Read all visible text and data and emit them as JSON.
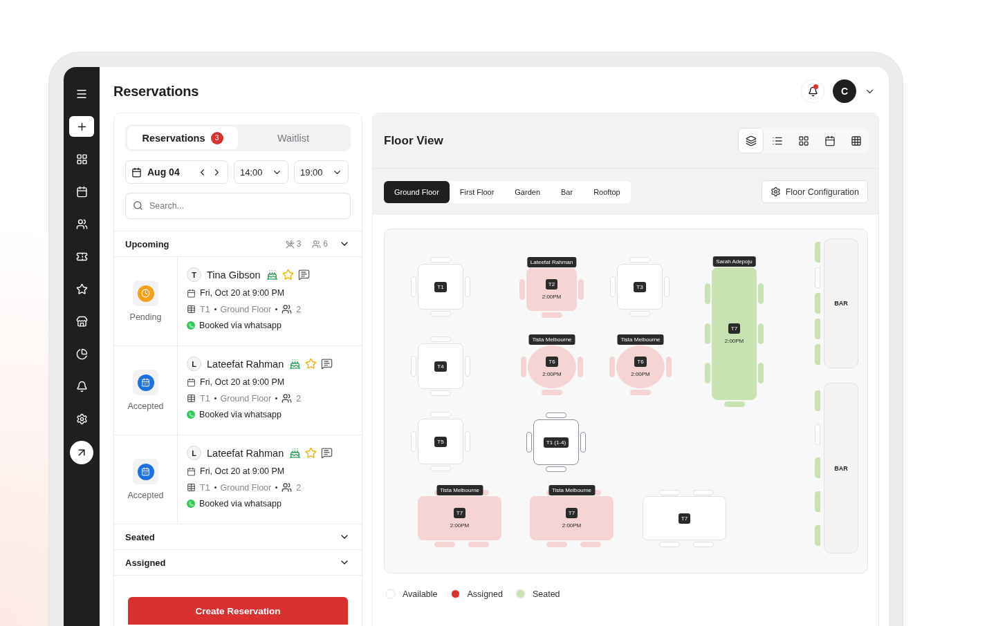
{
  "header": {
    "title": "Reservations",
    "avatar": "C",
    "has_notification": true
  },
  "panel": {
    "tabs": [
      {
        "label": "Reservations",
        "badge": "3",
        "selected": true
      },
      {
        "label": "Waitlist",
        "selected": false
      }
    ],
    "date": "Aug 04",
    "time_from": "14:00",
    "time_to": "19:00",
    "search": {
      "placeholder": "Search..."
    },
    "sections": [
      {
        "title": "Upcoming",
        "utensils_count": "3",
        "guests_count": "6",
        "items": [
          {
            "kind": "pending",
            "status_label": "Pending",
            "initial": "T",
            "name": "Tina Gibson",
            "datetime": "Fri, Oct 20 at 9:00 PM",
            "table": "T1",
            "floor": "Ground Floor",
            "guests": "2",
            "source": "Booked via whatsapp"
          },
          {
            "kind": "accepted",
            "status_label": "Accepted",
            "initial": "L",
            "name": "Lateefat Rahman",
            "datetime": "Fri, Oct 20 at 9:00 PM",
            "table": "T1",
            "floor": "Ground Floor",
            "guests": "2",
            "source": "Booked via whatsapp"
          },
          {
            "kind": "accepted",
            "status_label": "Accepted",
            "initial": "L",
            "name": "Lateefat Rahman",
            "datetime": "Fri, Oct 20 at 9:00 PM",
            "table": "T1",
            "floor": "Ground Floor",
            "guests": "2",
            "source": "Booked via whatsapp"
          }
        ]
      },
      {
        "title": "Seated"
      },
      {
        "title": "Assigned"
      }
    ],
    "create_button": "Create Reservation"
  },
  "floor": {
    "title": "Floor View",
    "view_modes": [
      {
        "selected": true
      },
      {
        "selected": false
      },
      {
        "selected": false
      },
      {
        "selected": false
      },
      {
        "selected": false
      }
    ],
    "floors": [
      {
        "label": "Ground Floor",
        "selected": true
      },
      {
        "label": "First Floor",
        "selected": false
      },
      {
        "label": "Garden",
        "selected": false
      },
      {
        "label": "Bar",
        "selected": false
      },
      {
        "label": "Rooftop",
        "selected": false
      }
    ],
    "config_button": "Floor Configuration",
    "tables": [
      {
        "label": "T1",
        "kind": "square",
        "color": "#ffffff",
        "selected": false
      },
      {
        "label": "T2",
        "kind": "square",
        "color": "#f6d4d4",
        "selected": false,
        "guest": "Lateefat Rahman",
        "time": "2:00PM"
      },
      {
        "label": "T3",
        "kind": "square",
        "color": "#ffffff",
        "selected": false
      },
      {
        "label": "T7",
        "kind": "tall",
        "color": "#c8e3b2",
        "selected": false,
        "guest": "Sarah Adepoju",
        "time": "2:00PM"
      },
      {
        "label": "T4",
        "kind": "square",
        "color": "#ffffff",
        "selected": false
      },
      {
        "label": "T6",
        "kind": "round",
        "color": "#f6d4d4",
        "selected": false,
        "guest": "Tista Melbourne",
        "time": "2:00PM"
      },
      {
        "label": "T6",
        "kind": "round",
        "color": "#f6d4d4",
        "selected": false,
        "guest": "Tista Melbourne",
        "time": "2:00PM"
      },
      {
        "label": "T5",
        "kind": "square",
        "color": "#ffffff",
        "selected": false
      },
      {
        "label": "T1 (1-4)",
        "kind": "square",
        "color": "#ffffff",
        "selected": true
      },
      {
        "label": "T7",
        "kind": "wide",
        "color": "#f6d4d4",
        "selected": false,
        "guest": "Tista Melbourne",
        "time": "2:00PM"
      },
      {
        "label": "T7",
        "kind": "wide",
        "color": "#f6d4d4",
        "selected": false,
        "guest": "Tista Melbourne",
        "time": "2:00PM"
      },
      {
        "label": "T7",
        "kind": "wide",
        "color": "#ffffff",
        "selected": false
      }
    ],
    "bars": [
      {
        "label": "BAR",
        "stools": [
          {
            "seated": true
          },
          {
            "seated": false
          },
          {
            "seated": true
          },
          {
            "seated": true
          },
          {
            "seated": true
          }
        ]
      },
      {
        "label": "BAR",
        "stools": [
          {
            "seated": true
          },
          {
            "seated": false
          },
          {
            "seated": true
          },
          {
            "seated": true
          },
          {
            "seated": true
          }
        ]
      }
    ],
    "legend": [
      {
        "label": "Available",
        "color": "#ffffff"
      },
      {
        "label": "Assigned",
        "color": "#d93030"
      },
      {
        "label": "Seated",
        "color": "#c8e3b2"
      }
    ]
  }
}
